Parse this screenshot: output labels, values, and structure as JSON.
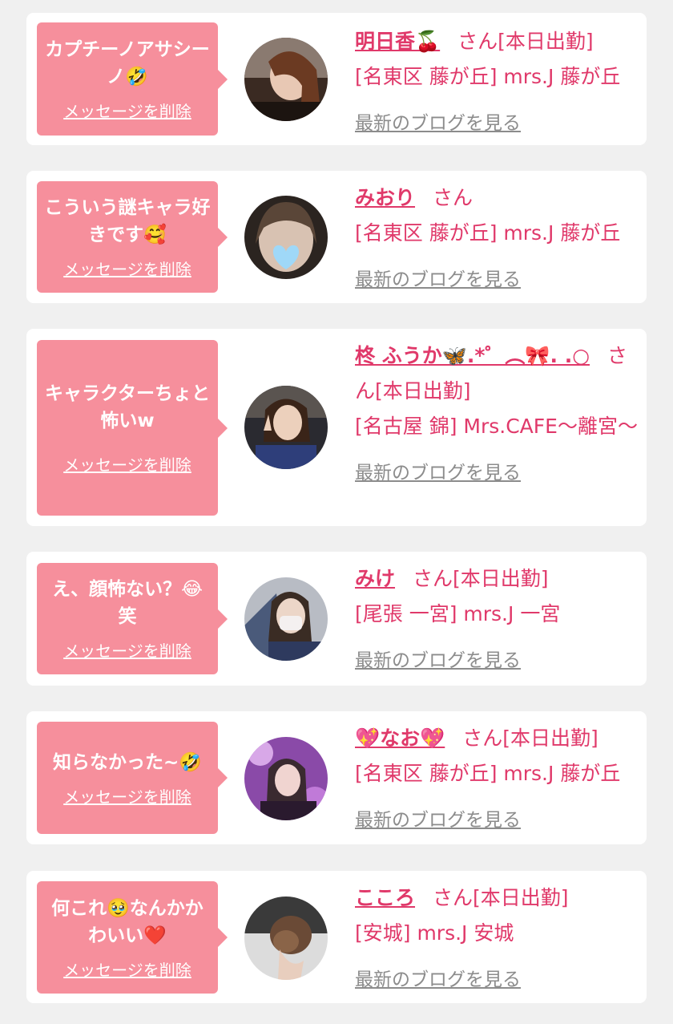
{
  "colors": {
    "background": "#f0f0f0",
    "card": "#ffffff",
    "bubble": "#f68f9c",
    "accent": "#e0396a",
    "link_gray": "#8c8c8c"
  },
  "delete_label": "メッセージを削除",
  "blog_label": "最新のブログを見る",
  "honorific": "さん",
  "messages": [
    {
      "text": "カプチーノアサシーノ🤣",
      "name": "明日香🍒",
      "status": "[本日出勤]",
      "location": "[名東区 藤が丘] mrs.J 藤が丘",
      "avatar_icon": "avatar-photo-icon"
    },
    {
      "text": "こういう謎キャラ好きです🥰",
      "name": "みおり",
      "status": "",
      "location": "[名東区 藤が丘] mrs.J 藤が丘",
      "avatar_icon": "avatar-photo-icon"
    },
    {
      "text": "キャラクターちょと怖いw",
      "name": "柊 ふうか🦋.*゜︵🎀. .○",
      "status": "[本日出勤]",
      "location": "[名古屋 錦] Mrs.CAFE〜離宮〜",
      "avatar_icon": "avatar-photo-icon"
    },
    {
      "text": "え、顔怖ない？😂笑",
      "name": "みけ",
      "status": "[本日出勤]",
      "location": "[尾張 一宮] mrs.J 一宮",
      "avatar_icon": "avatar-photo-icon"
    },
    {
      "text": "知らなかった~🤣",
      "name": "💖なお💖",
      "status": "[本日出勤]",
      "location": "[名東区 藤が丘] mrs.J 藤が丘",
      "avatar_icon": "avatar-photo-icon"
    },
    {
      "text": "何これ🥹なんかかわいい❤️",
      "name": "こころ",
      "status": "[本日出勤]",
      "location": "[安城] mrs.J 安城",
      "avatar_icon": "avatar-photo-icon"
    }
  ]
}
